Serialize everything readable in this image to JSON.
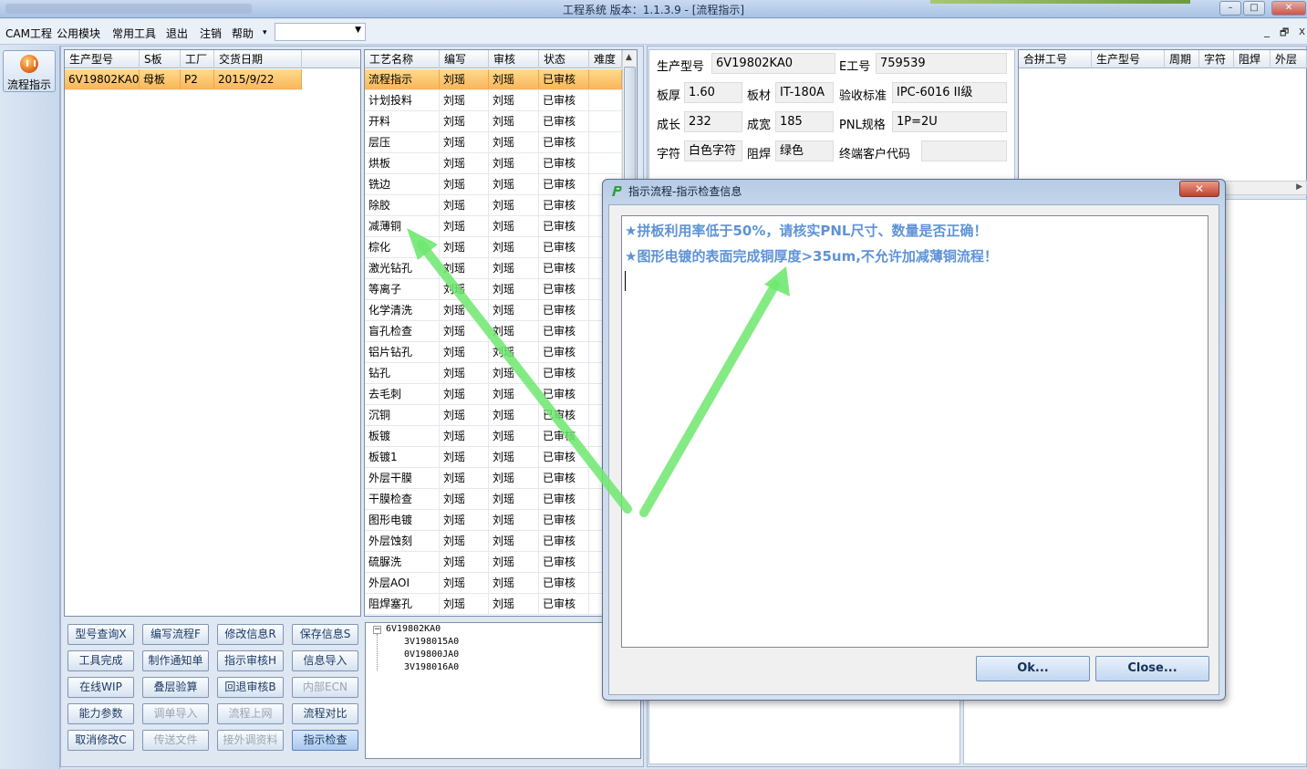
{
  "window": {
    "title": "工程系统   版本：1.1.3.9 - [流程指示]",
    "controls": [
      "minimize-icon",
      "maximize-icon",
      "close-icon"
    ]
  },
  "menu": {
    "items": [
      "CAM工程",
      "公用模块",
      "常用工具",
      "退出",
      "注销",
      "帮助"
    ],
    "combo_value": "",
    "mdi": [
      "_",
      "🗗",
      "x"
    ]
  },
  "nav": {
    "button_label": "流程指示"
  },
  "order_grid": {
    "headers": [
      "生产型号",
      "S板",
      "工厂",
      "交货日期"
    ],
    "rows": [
      [
        "6V19802KA0",
        "母板",
        "P2",
        "2015/9/22"
      ]
    ]
  },
  "process_grid": {
    "headers": [
      "工艺名称",
      "编写",
      "审核",
      "状态",
      "难度"
    ],
    "rows": [
      [
        "流程指示",
        "刘瑶",
        "刘瑶",
        "已审核",
        ""
      ],
      [
        "计划投料",
        "刘瑶",
        "刘瑶",
        "已审核",
        ""
      ],
      [
        "开料",
        "刘瑶",
        "刘瑶",
        "已审核",
        ""
      ],
      [
        "层压",
        "刘瑶",
        "刘瑶",
        "已审核",
        ""
      ],
      [
        "烘板",
        "刘瑶",
        "刘瑶",
        "已审核",
        ""
      ],
      [
        "铣边",
        "刘瑶",
        "刘瑶",
        "已审核",
        ""
      ],
      [
        "除胶",
        "刘瑶",
        "刘瑶",
        "已审核",
        ""
      ],
      [
        "减薄铜",
        "刘瑶",
        "刘瑶",
        "已审核",
        ""
      ],
      [
        "棕化",
        "刘瑶",
        "刘瑶",
        "已审核",
        ""
      ],
      [
        "激光钻孔",
        "刘瑶",
        "刘瑶",
        "已审核",
        ""
      ],
      [
        "等离子",
        "刘瑶",
        "刘瑶",
        "已审核",
        ""
      ],
      [
        "化学清洗",
        "刘瑶",
        "刘瑶",
        "已审核",
        ""
      ],
      [
        "盲孔检查",
        "刘瑶",
        "刘瑶",
        "已审核",
        ""
      ],
      [
        "铝片钻孔",
        "刘瑶",
        "刘瑶",
        "已审核",
        ""
      ],
      [
        "钻孔",
        "刘瑶",
        "刘瑶",
        "已审核",
        ""
      ],
      [
        "去毛刺",
        "刘瑶",
        "刘瑶",
        "已审核",
        ""
      ],
      [
        "沉铜",
        "刘瑶",
        "刘瑶",
        "已审核",
        ""
      ],
      [
        "板镀",
        "刘瑶",
        "刘瑶",
        "已审核",
        ""
      ],
      [
        "板镀1",
        "刘瑶",
        "刘瑶",
        "已审核",
        ""
      ],
      [
        "外层干膜",
        "刘瑶",
        "刘瑶",
        "已审核",
        ""
      ],
      [
        "干膜检查",
        "刘瑶",
        "刘瑶",
        "已审核",
        ""
      ],
      [
        "图形电镀",
        "刘瑶",
        "刘瑶",
        "已审核",
        ""
      ],
      [
        "外层蚀刻",
        "刘瑶",
        "刘瑶",
        "已审核",
        ""
      ],
      [
        "硫脲洗",
        "刘瑶",
        "刘瑶",
        "已审核",
        ""
      ],
      [
        "外层AOI",
        "刘瑶",
        "刘瑶",
        "已审核",
        ""
      ],
      [
        "阻焊塞孔",
        "刘瑶",
        "刘瑶",
        "已审核",
        ""
      ]
    ]
  },
  "tree": {
    "root": "6V19802KA0",
    "children": [
      "3V198015A0",
      "0V19800JA0",
      "3V198016A0"
    ]
  },
  "buttons": [
    {
      "label": "型号查询X",
      "enabled": true
    },
    {
      "label": "编写流程F",
      "enabled": true
    },
    {
      "label": "修改信息R",
      "enabled": true
    },
    {
      "label": "保存信息S",
      "enabled": true
    },
    {
      "label": "工具完成",
      "enabled": true
    },
    {
      "label": "制作通知单",
      "enabled": true
    },
    {
      "label": "指示审核H",
      "enabled": true
    },
    {
      "label": "信息导入",
      "enabled": true
    },
    {
      "label": "在线WIP",
      "enabled": true
    },
    {
      "label": "叠层验算",
      "enabled": true
    },
    {
      "label": "回退审核B",
      "enabled": true
    },
    {
      "label": "内部ECN",
      "enabled": false
    },
    {
      "label": "能力参数",
      "enabled": true
    },
    {
      "label": "调单导入",
      "enabled": false
    },
    {
      "label": "流程上网",
      "enabled": false
    },
    {
      "label": "流程对比",
      "enabled": true
    },
    {
      "label": "取消修改C",
      "enabled": true
    },
    {
      "label": "传送文件",
      "enabled": false
    },
    {
      "label": "接外调资料",
      "enabled": false
    },
    {
      "label": "指示检查",
      "enabled": true
    }
  ],
  "info": {
    "model_label": "生产型号",
    "model": "6V19802KA0",
    "e_label": "E工号",
    "e_value": "759539",
    "thick_label": "板厚",
    "thick": "1.60",
    "material_label": "板材",
    "material": "IT-180A",
    "std_label": "验收标准",
    "std": "IPC-6016 II级",
    "len_label": "成长",
    "len": "232",
    "width_label": "成宽",
    "width": "185",
    "pnl_label": "PNL规格",
    "pnl": "1P=2U",
    "char_label": "字符",
    "char": "白色字符",
    "mask_label": "阻焊",
    "mask": "绿色",
    "customer_label": "终端客户代码",
    "customer": ""
  },
  "merge_grid": {
    "headers": [
      "合拼工号",
      "生产型号",
      "周期",
      "字符",
      "阻焊",
      "外层"
    ]
  },
  "dialog": {
    "title": "指示流程-指示检查信息",
    "messages": [
      "★拼板利用率低于50%，请核实PNL尺寸、数量是否正确！",
      "★图形电镀的表面完成铜厚度>35um,不允许加减薄铜流程！"
    ],
    "ok_label": "Ok...",
    "close_label": "Close..."
  },
  "colors": {
    "selection": "#f8b55a",
    "message_text": "#5e93d6",
    "arrow": "#6fe86f"
  }
}
